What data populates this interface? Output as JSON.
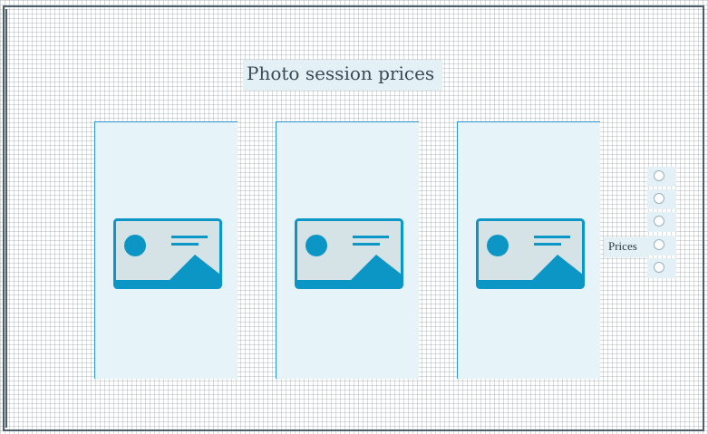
{
  "page": {
    "title": "Photo session prices"
  },
  "cards": [
    {
      "icon": "image-placeholder-icon"
    },
    {
      "icon": "image-placeholder-icon"
    },
    {
      "icon": "image-placeholder-icon"
    }
  ],
  "pager": {
    "label": "Prices",
    "items": [
      {
        "selected": false
      },
      {
        "selected": false
      },
      {
        "selected": false
      },
      {
        "selected": false
      },
      {
        "selected": false
      }
    ]
  },
  "colors": {
    "accent": "#2d93cf",
    "image_blue": "#0b96c6",
    "panel_bg": "#e6f3f8",
    "frame": "#4e5f6b"
  }
}
